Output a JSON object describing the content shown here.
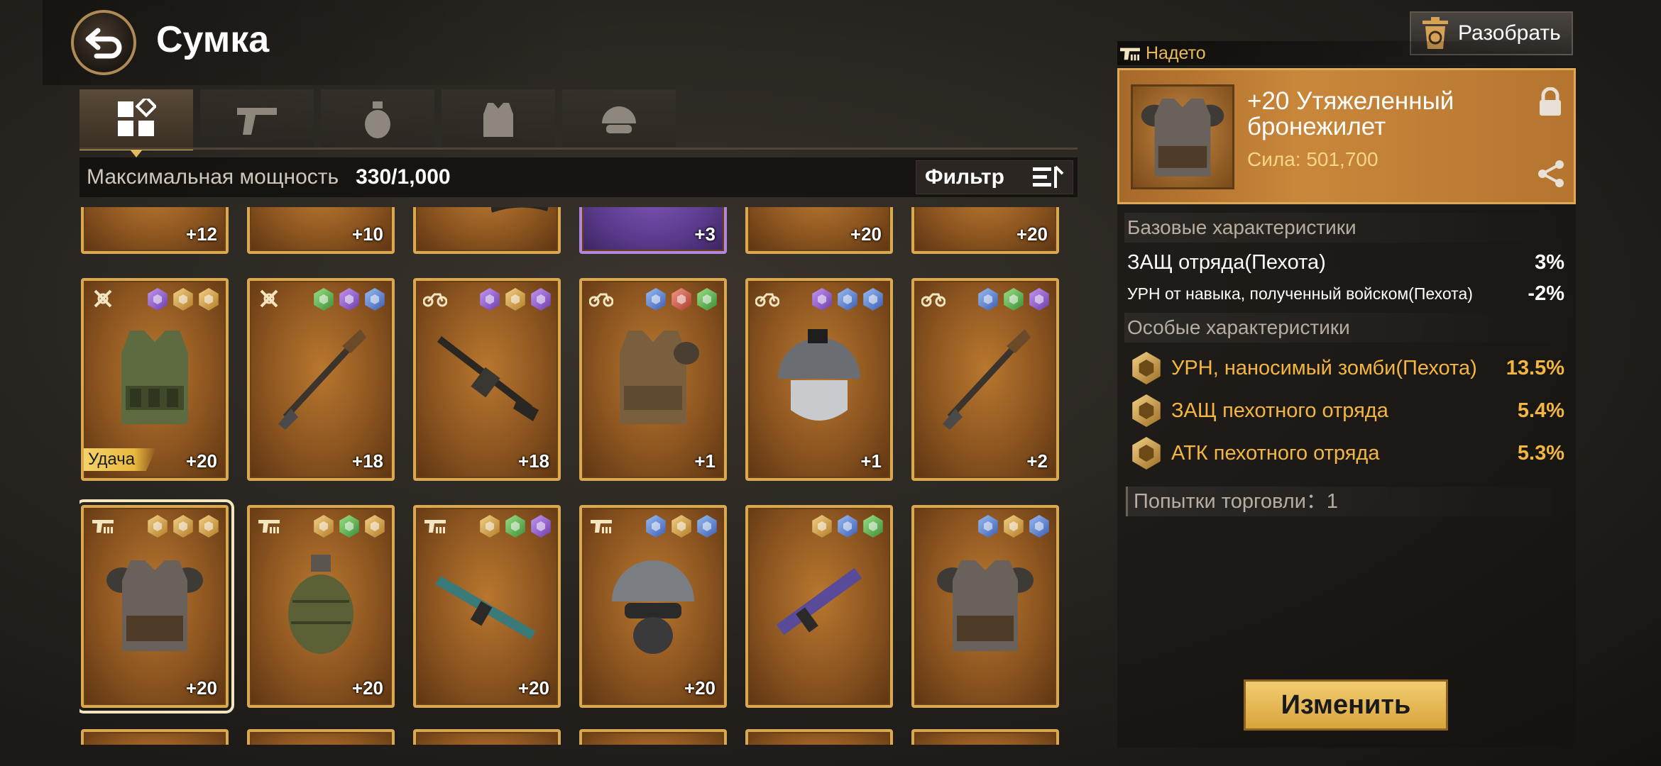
{
  "header": {
    "title": "Сумка"
  },
  "tabs": [
    {
      "id": "all",
      "icon": "grid-icon"
    },
    {
      "id": "weapon",
      "icon": "pistol-icon"
    },
    {
      "id": "grenade",
      "icon": "grenade-icon"
    },
    {
      "id": "armor",
      "icon": "vest-icon"
    },
    {
      "id": "helmet",
      "icon": "helmet-icon"
    }
  ],
  "power": {
    "label": "Максимальная мощность",
    "value": "330/1,000"
  },
  "filter": {
    "label": "Фильтр"
  },
  "grid": {
    "partial_row_top": [
      "+12",
      "+10",
      "",
      "+3",
      "+20",
      "+20"
    ],
    "row1": [
      {
        "item": "body-armor",
        "type": "crossed-guns-icon",
        "gems": [
          "purple",
          "gold",
          "gold"
        ],
        "level": "+20",
        "badge": "Удача"
      },
      {
        "item": "rocket-launcher",
        "type": "crossed-guns-icon",
        "gems": [
          "green",
          "purple",
          "blue"
        ],
        "level": "+18"
      },
      {
        "item": "heavy-rifle",
        "type": "motorcycle-icon",
        "gems": [
          "purple",
          "gold",
          "purple"
        ],
        "level": "+18"
      },
      {
        "item": "body-armor",
        "type": "motorcycle-icon",
        "gems": [
          "blue",
          "red",
          "green"
        ],
        "level": "+1"
      },
      {
        "item": "helmet",
        "type": "motorcycle-icon",
        "gems": [
          "purple",
          "blue",
          "blue"
        ],
        "level": "+1"
      },
      {
        "item": "rocket-launcher",
        "type": "motorcycle-icon",
        "gems": [
          "blue",
          "green",
          "purple"
        ],
        "level": "+2"
      }
    ],
    "row2": [
      {
        "item": "body-armor",
        "type": "infantry-icon",
        "gems": [
          "gold",
          "gold",
          "gold"
        ],
        "level": "+20"
      },
      {
        "item": "grenade",
        "type": "infantry-icon",
        "gems": [
          "gold",
          "green",
          "gold"
        ],
        "level": "+20"
      },
      {
        "item": "assault-rifle",
        "type": "infantry-icon",
        "gems": [
          "gold",
          "green",
          "purple"
        ],
        "level": "+20"
      },
      {
        "item": "helmet",
        "type": "infantry-icon",
        "gems": [
          "blue",
          "gold",
          "blue"
        ],
        "level": "+20"
      },
      {
        "item": "smg",
        "type": "infantry-icon",
        "gems": [
          "gold",
          "blue",
          "green"
        ],
        "level": ""
      },
      {
        "item": "body-armor",
        "type": "infantry-icon",
        "gems": [
          "blue",
          "gold",
          "blue"
        ],
        "level": ""
      }
    ]
  },
  "dismantle": {
    "label": "Разобрать"
  },
  "equipped": {
    "tag": "Надето",
    "name": "+20 Утяжеленный бронежилет",
    "power": "Сила: 501,700"
  },
  "base_stats": {
    "heading": "Базовые характеристики",
    "rows": [
      {
        "name": "ЗАЩ отряда(Пехота)",
        "value": "3%"
      },
      {
        "name": "УРН от навыка, полученный войском(Пехота)",
        "value": "-2%"
      }
    ]
  },
  "special_stats": {
    "heading": "Особые характеристики",
    "rows": [
      {
        "name": "УРН, наносимый зомби(Пехота)",
        "value": "13.5%"
      },
      {
        "name": "ЗАЩ пехотного отряда",
        "value": "5.4%"
      },
      {
        "name": "АТК пехотного отряда",
        "value": "5.3%"
      }
    ]
  },
  "trade": {
    "text": "Попытки торговли：1"
  },
  "change_button": {
    "label": "Изменить"
  }
}
